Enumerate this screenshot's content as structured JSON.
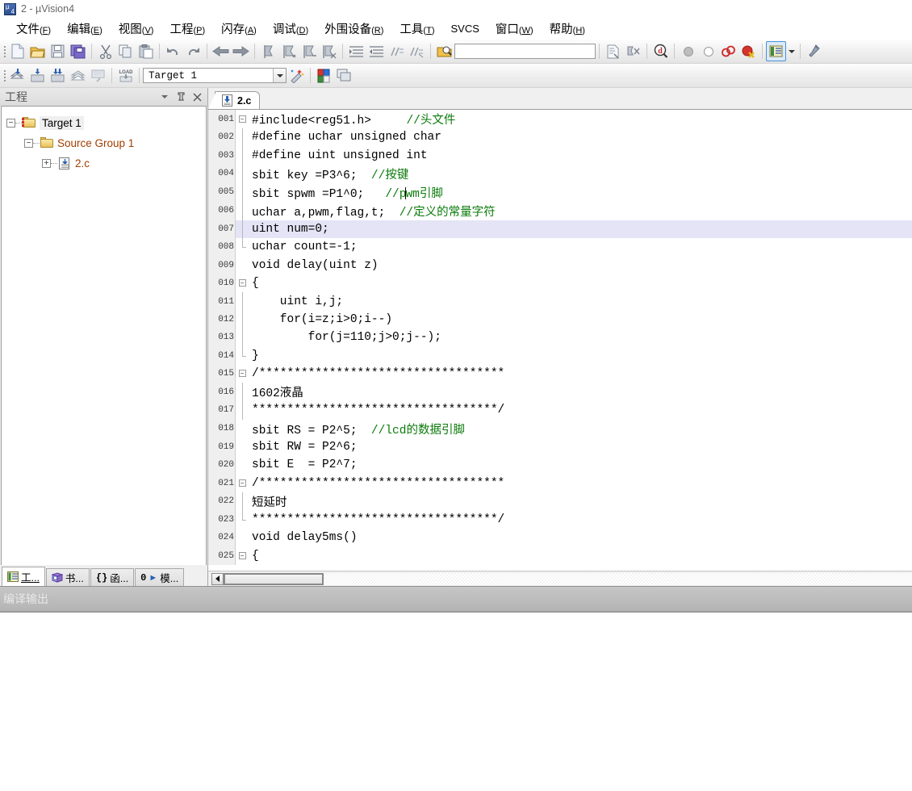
{
  "window": {
    "title": "2 - µVision4",
    "icon": "uvision-icon"
  },
  "menubar": [
    {
      "label": "文件",
      "mnemonic": "F",
      "name": "menu-file"
    },
    {
      "label": "编辑",
      "mnemonic": "E",
      "name": "menu-edit"
    },
    {
      "label": "视图",
      "mnemonic": "V",
      "name": "menu-view"
    },
    {
      "label": "工程",
      "mnemonic": "P",
      "name": "menu-project"
    },
    {
      "label": "闪存",
      "mnemonic": "A",
      "name": "menu-flash"
    },
    {
      "label": "调试",
      "mnemonic": "D",
      "name": "menu-debug"
    },
    {
      "label": "外围设备",
      "mnemonic": "R",
      "name": "menu-peripherals"
    },
    {
      "label": "工具",
      "mnemonic": "T",
      "name": "menu-tools"
    },
    {
      "label": "SVCS",
      "mnemonic": "S",
      "name": "menu-svcs"
    },
    {
      "label": "窗口",
      "mnemonic": "W",
      "name": "menu-window"
    },
    {
      "label": "帮助",
      "mnemonic": "H",
      "name": "menu-help"
    }
  ],
  "toolbar_main": {
    "icons": [
      "new-file-icon",
      "open-folder-icon",
      "save-icon",
      "save-all-icon",
      "cut-icon",
      "copy-icon",
      "paste-icon",
      "undo-icon",
      "redo-icon",
      "navigate-back-icon",
      "navigate-forward-icon",
      "bookmark-toggle-icon",
      "bookmark-prev-icon",
      "bookmark-next-icon",
      "bookmark-clear-icon",
      "indent-icon",
      "outdent-icon",
      "comment-icon",
      "uncomment-icon",
      "find-in-files-icon"
    ],
    "search_value": "",
    "search_placeholder": "",
    "icons_right": [
      "source-browse-icon",
      "goto-definition-icon",
      "find-icon",
      "breakpoint-icon",
      "breakpoint-disabled-icon",
      "breakpoint-disable-all-icon",
      "breakpoint-kill-all-icon",
      "window-layout-icon",
      "configure-icon"
    ]
  },
  "toolbar_build": {
    "icons": [
      "translate-icon",
      "build-icon",
      "rebuild-icon",
      "batch-build-icon",
      "stop-build-icon",
      "download-icon"
    ],
    "download_label": "LOAD",
    "target_value": "Target 1",
    "icons_right": [
      "target-options-icon",
      "manage-components-icon",
      "project-window-icon"
    ]
  },
  "project_panel": {
    "title": "工程",
    "header_buttons": [
      "dropdown-icon",
      "pin-icon",
      "close-icon"
    ],
    "tree": [
      {
        "label": "Target 1",
        "icon": "target-folder-icon",
        "expander": "−",
        "level": 1,
        "selected": true
      },
      {
        "label": "Source Group 1",
        "icon": "source-group-folder-icon",
        "expander": "−",
        "level": 2,
        "selected": false
      },
      {
        "label": "2.c",
        "icon": "c-file-icon",
        "expander": "+",
        "level": 3,
        "selected": false
      }
    ],
    "tabs": [
      {
        "label": "工...",
        "icon": "project-icon",
        "active": true,
        "name": "tab-project"
      },
      {
        "label": "书...",
        "icon": "books-icon",
        "active": false,
        "name": "tab-books"
      },
      {
        "label": "函...",
        "icon": "functions-icon",
        "prefix": "{}",
        "active": false,
        "name": "tab-functions"
      },
      {
        "label": "模...",
        "icon": "templates-icon",
        "prefix": "0",
        "active": false,
        "name": "tab-templates"
      }
    ]
  },
  "editor": {
    "tabs": [
      {
        "label": "2.c",
        "icon": "c-file-icon",
        "active": true
      }
    ],
    "current_line": 7,
    "lines": [
      {
        "n": "001",
        "fold": "open",
        "text": "#include<reg51.h>",
        "comment": "     //头文件"
      },
      {
        "n": "002",
        "fold": "bar",
        "text": "#define uchar unsigned char",
        "comment": ""
      },
      {
        "n": "003",
        "fold": "bar",
        "text": "#define uint unsigned int",
        "comment": ""
      },
      {
        "n": "004",
        "fold": "bar",
        "text": "sbit key =P3^6;",
        "comment": "  //按键"
      },
      {
        "n": "005",
        "fold": "bar",
        "text": "sbit spwm =P1^0;",
        "comment": "   //pwm引脚",
        "cursor_after_comment_chars": 6
      },
      {
        "n": "006",
        "fold": "bar",
        "text": "uchar a,pwm,flag,t;",
        "comment": "  //定义的常量字符"
      },
      {
        "n": "007",
        "fold": "bar",
        "text": "uint num=0;",
        "comment": ""
      },
      {
        "n": "008",
        "fold": "close",
        "text": "uchar count=-1;",
        "comment": ""
      },
      {
        "n": "009",
        "fold": "none",
        "text": "void delay(uint z)",
        "comment": ""
      },
      {
        "n": "010",
        "fold": "open",
        "text": "{",
        "comment": ""
      },
      {
        "n": "011",
        "fold": "bar",
        "text": "    uint i,j;",
        "comment": ""
      },
      {
        "n": "012",
        "fold": "bar",
        "text": "    for(i=z;i>0;i--)",
        "comment": ""
      },
      {
        "n": "013",
        "fold": "bar",
        "text": "        for(j=110;j>0;j--);",
        "comment": ""
      },
      {
        "n": "014",
        "fold": "close",
        "text": "}",
        "comment": ""
      },
      {
        "n": "015",
        "fold": "open",
        "text": "/***********************************",
        "comment": ""
      },
      {
        "n": "016",
        "fold": "bar",
        "text": "1602液晶",
        "comment": ""
      },
      {
        "n": "017",
        "fold": "bar",
        "text": "***********************************/",
        "comment": ""
      },
      {
        "n": "018",
        "fold": "none",
        "text": "sbit RS = P2^5;",
        "comment": "  //lcd的数据引脚"
      },
      {
        "n": "019",
        "fold": "none",
        "text": "sbit RW = P2^6;",
        "comment": ""
      },
      {
        "n": "020",
        "fold": "none",
        "text": "sbit E  = P2^7;",
        "comment": ""
      },
      {
        "n": "021",
        "fold": "open",
        "text": "/***********************************",
        "comment": ""
      },
      {
        "n": "022",
        "fold": "bar",
        "text": "短延时",
        "comment": ""
      },
      {
        "n": "023",
        "fold": "close",
        "text": "***********************************/",
        "comment": ""
      },
      {
        "n": "024",
        "fold": "none",
        "text": "void delay5ms()",
        "comment": ""
      },
      {
        "n": "025",
        "fold": "open",
        "text": "{",
        "comment": ""
      }
    ],
    "hscroll": {
      "left_arrow": "scroll-left-icon"
    }
  },
  "build_output": {
    "title": "编译输出"
  },
  "colors": {
    "accent": "#4a90d9",
    "comment": "#0a7a0a",
    "tree_text": "#a33d00",
    "current_line": "#e4e4f6",
    "gutter": "#efefef",
    "panel": "#f0f0f0",
    "build_bar": "#bdbdbd"
  }
}
